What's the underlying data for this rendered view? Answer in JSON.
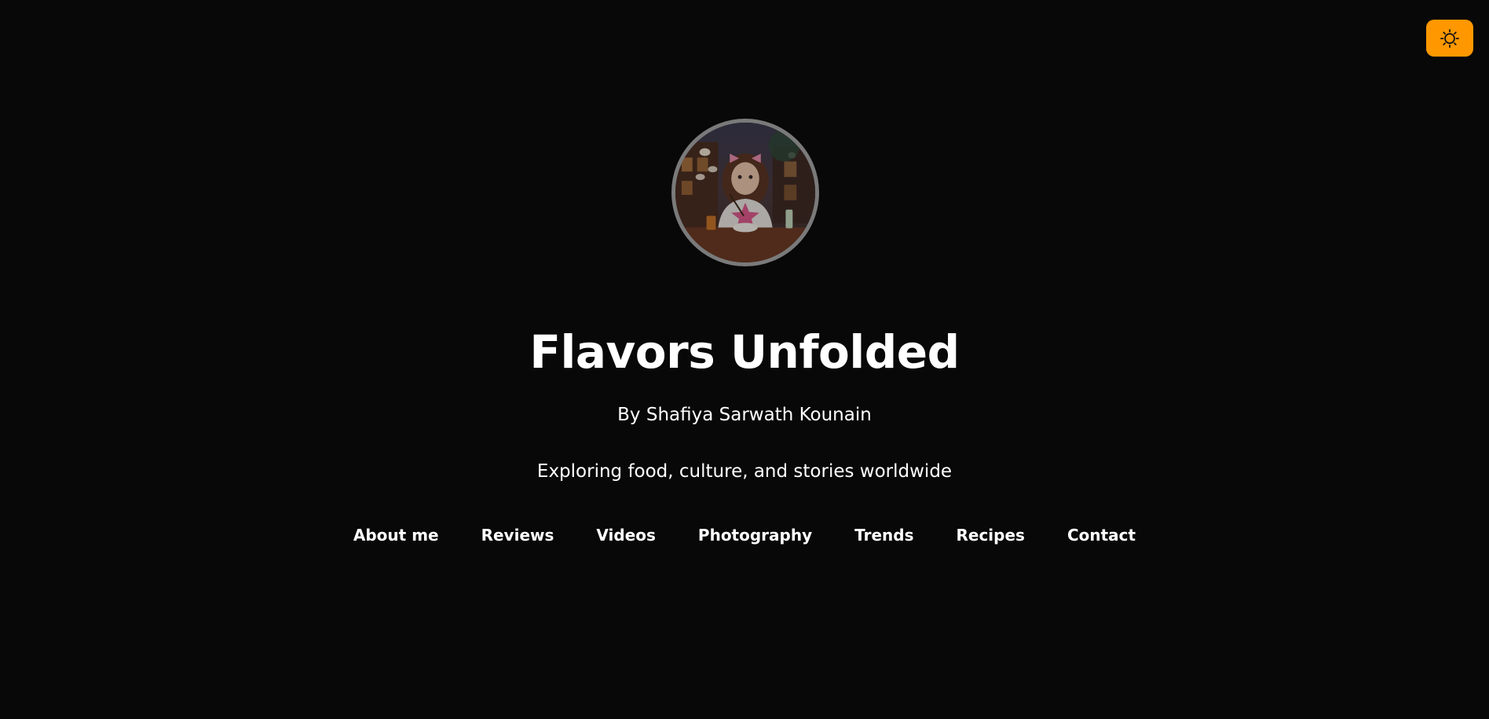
{
  "header": {
    "theme_toggle_icon": "sun-icon",
    "theme_toggle_color": "#ff9800"
  },
  "hero": {
    "title": "Flavors Unfolded",
    "author": "By Shafiya Sarwath Kounain",
    "tagline": "Exploring food, culture, and stories worldwide"
  },
  "nav": {
    "items": [
      {
        "label": "About me"
      },
      {
        "label": "Reviews"
      },
      {
        "label": "Videos"
      },
      {
        "label": "Photography"
      },
      {
        "label": "Trends"
      },
      {
        "label": "Recipes"
      },
      {
        "label": "Contact"
      }
    ]
  }
}
